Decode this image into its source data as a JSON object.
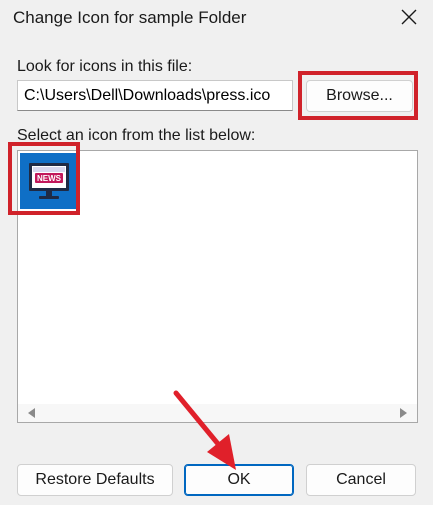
{
  "dialog": {
    "title": "Change Icon for sample Folder",
    "look_for_label": "Look for icons in this file:",
    "file_path": "C:\\Users\\Dell\\Downloads\\press.ico",
    "browse_label": "Browse...",
    "select_label": "Select an icon from the list below:",
    "icons": [
      {
        "name": "news-monitor-icon",
        "text": "NEWS",
        "selected": true
      }
    ],
    "buttons": {
      "restore": "Restore Defaults",
      "ok": "OK",
      "cancel": "Cancel"
    }
  },
  "annotations": {
    "highlight_color": "#d0222a",
    "arrow_color": "#e0202a"
  }
}
